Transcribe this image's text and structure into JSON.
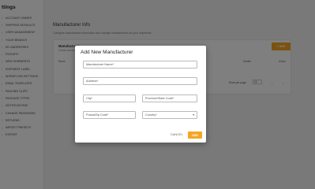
{
  "sidebar": {
    "title": "ttings",
    "items": [
      {
        "label": "ACCOUNT OWNER"
      },
      {
        "label": "SHIPPING DEFAULTS"
      },
      {
        "label": "USER MANAGEMENT"
      },
      {
        "label": "YOUR BRANCH"
      },
      {
        "label": "MY ADDRESSES"
      },
      {
        "label": "PICKUPS"
      },
      {
        "label": "NEW SHIPMENTS"
      },
      {
        "label": "SHIPMENT LABEL"
      },
      {
        "label": "WORKFLOW SETTINGS"
      },
      {
        "label": "EMAIL TEMPLATES"
      },
      {
        "label": "PACKING SLIPS"
      },
      {
        "label": "PACKAGE TYPES"
      },
      {
        "label": "NOTIFICATIONS"
      },
      {
        "label": "CHANGE PASSWORD"
      },
      {
        "label": "RETURNS"
      },
      {
        "label": "IMPORT PRESETS"
      },
      {
        "label": "EXPORT"
      }
    ]
  },
  "main": {
    "title": "Manufacturer Info",
    "description": "Configure manufacturer information and manage manufacturers for your shipments",
    "card": {
      "title": "Manufacturer",
      "subtitle": "Create and man",
      "add_button": "+ ADD",
      "columns": [
        "Name",
        "Details",
        "Action"
      ],
      "rows_per_page_label": "Rows per page:",
      "rows_per_page_value": "10"
    }
  },
  "modal": {
    "title": "Add New Manufacturer",
    "fields": {
      "name": "Manufacturer Name*",
      "address": "Address*",
      "city": "City*",
      "state": "Province/State Code*",
      "postal": "Postal/Zip Code*",
      "country": "Country*"
    },
    "cancel_label": "CANCEL",
    "add_label": "ADD"
  },
  "colors": {
    "accent": "#f5a623",
    "overlay": "rgba(0,0,0,0.5)"
  }
}
